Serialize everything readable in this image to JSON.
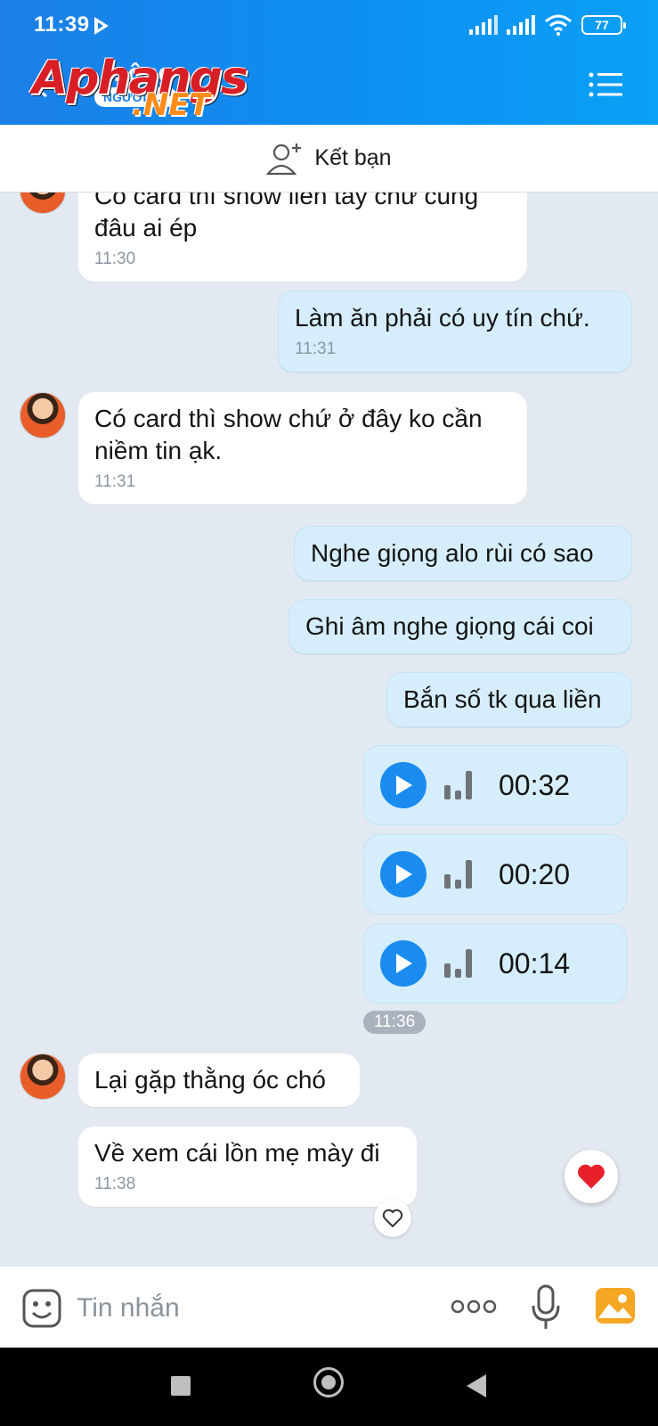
{
  "status": {
    "time": "11:39",
    "battery": "77"
  },
  "header": {
    "contact_name": "...ông",
    "contact_sub": "NGƯỜI L...",
    "watermark_main": "Aphangs",
    "watermark_net": ".NET"
  },
  "friend_bar": {
    "label": "Kết bạn"
  },
  "messages": [
    {
      "id": "m0",
      "dir": "in",
      "text": "Có card thì show liền tay chứ cũng đâu ai ép",
      "time": "11:30"
    },
    {
      "id": "m1",
      "dir": "out",
      "text": "Làm ăn phải có uy tín chứ.",
      "time": "11:31"
    },
    {
      "id": "m2",
      "dir": "in",
      "text": "Có card thì show chứ ở đây ko cần niềm tin ạk.",
      "time": "11:31"
    },
    {
      "id": "m3",
      "dir": "out",
      "text": "Nghe giọng alo rùi có sao"
    },
    {
      "id": "m4",
      "dir": "out",
      "text": "Ghi âm nghe giọng cái coi"
    },
    {
      "id": "m5",
      "dir": "out",
      "text": "Bắn số tk qua liền"
    },
    {
      "id": "v1",
      "dir": "out",
      "type": "voice",
      "duration": "00:32"
    },
    {
      "id": "v2",
      "dir": "out",
      "type": "voice",
      "duration": "00:20"
    },
    {
      "id": "v3",
      "dir": "out",
      "type": "voice",
      "duration": "00:14"
    },
    {
      "id": "m6",
      "dir": "in",
      "text": "Lại gặp thằng óc chó"
    },
    {
      "id": "m7",
      "dir": "in",
      "text": "Về xem cái lồn mẹ mày đi",
      "time": "11:38"
    }
  ],
  "voice_time_chip": "11:36",
  "input": {
    "placeholder": "Tin nhắn"
  },
  "colors": {
    "accent": "#1a8cf0",
    "out_bubble": "#d6eefc",
    "in_bubble": "#ffffff",
    "heart": "#e8202a"
  }
}
